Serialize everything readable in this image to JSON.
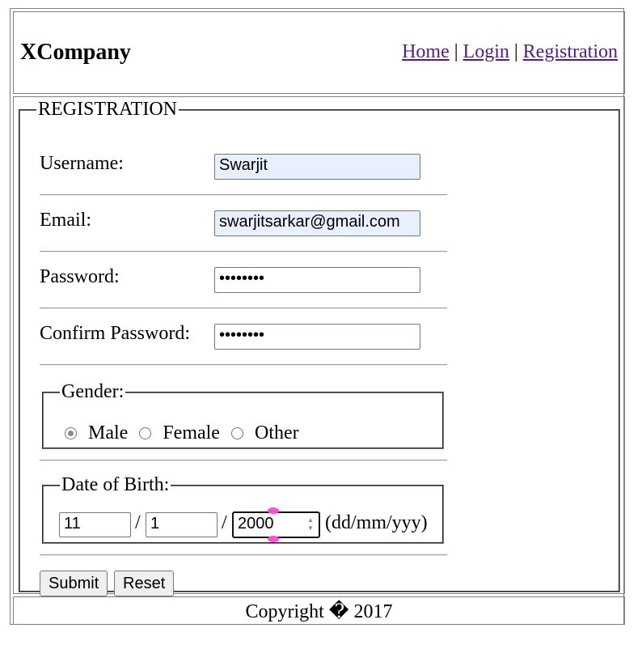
{
  "header": {
    "logo": "XCompany",
    "nav": [
      {
        "label": "Home"
      },
      {
        "label": "Login"
      },
      {
        "label": "Registration"
      }
    ],
    "separator": "|"
  },
  "form": {
    "legend": "REGISTRATION",
    "username": {
      "label": "Username:",
      "value": "Swarjit"
    },
    "email": {
      "label": "Email:",
      "value": "swarjitsarkar@gmail.com"
    },
    "password": {
      "label": "Password:",
      "value": "••••••••"
    },
    "confirm_password": {
      "label": "Confirm Password:",
      "value": "••••••••"
    },
    "gender": {
      "legend": "Gender:",
      "options": [
        {
          "label": "Male",
          "checked": true
        },
        {
          "label": "Female",
          "checked": false
        },
        {
          "label": "Other",
          "checked": false
        }
      ]
    },
    "dob": {
      "legend": "Date of Birth:",
      "day": "11",
      "month": "1",
      "year": "2000",
      "separator": "/",
      "format_hint": "(dd/mm/yyy)"
    },
    "submit_label": "Submit",
    "reset_label": "Reset"
  },
  "footer": {
    "copyright": "Copyright � 2017"
  },
  "colors": {
    "link": "#551a8b",
    "autofill_bg": "#e8f0fe",
    "focus_marker": "#ff4fd8"
  }
}
